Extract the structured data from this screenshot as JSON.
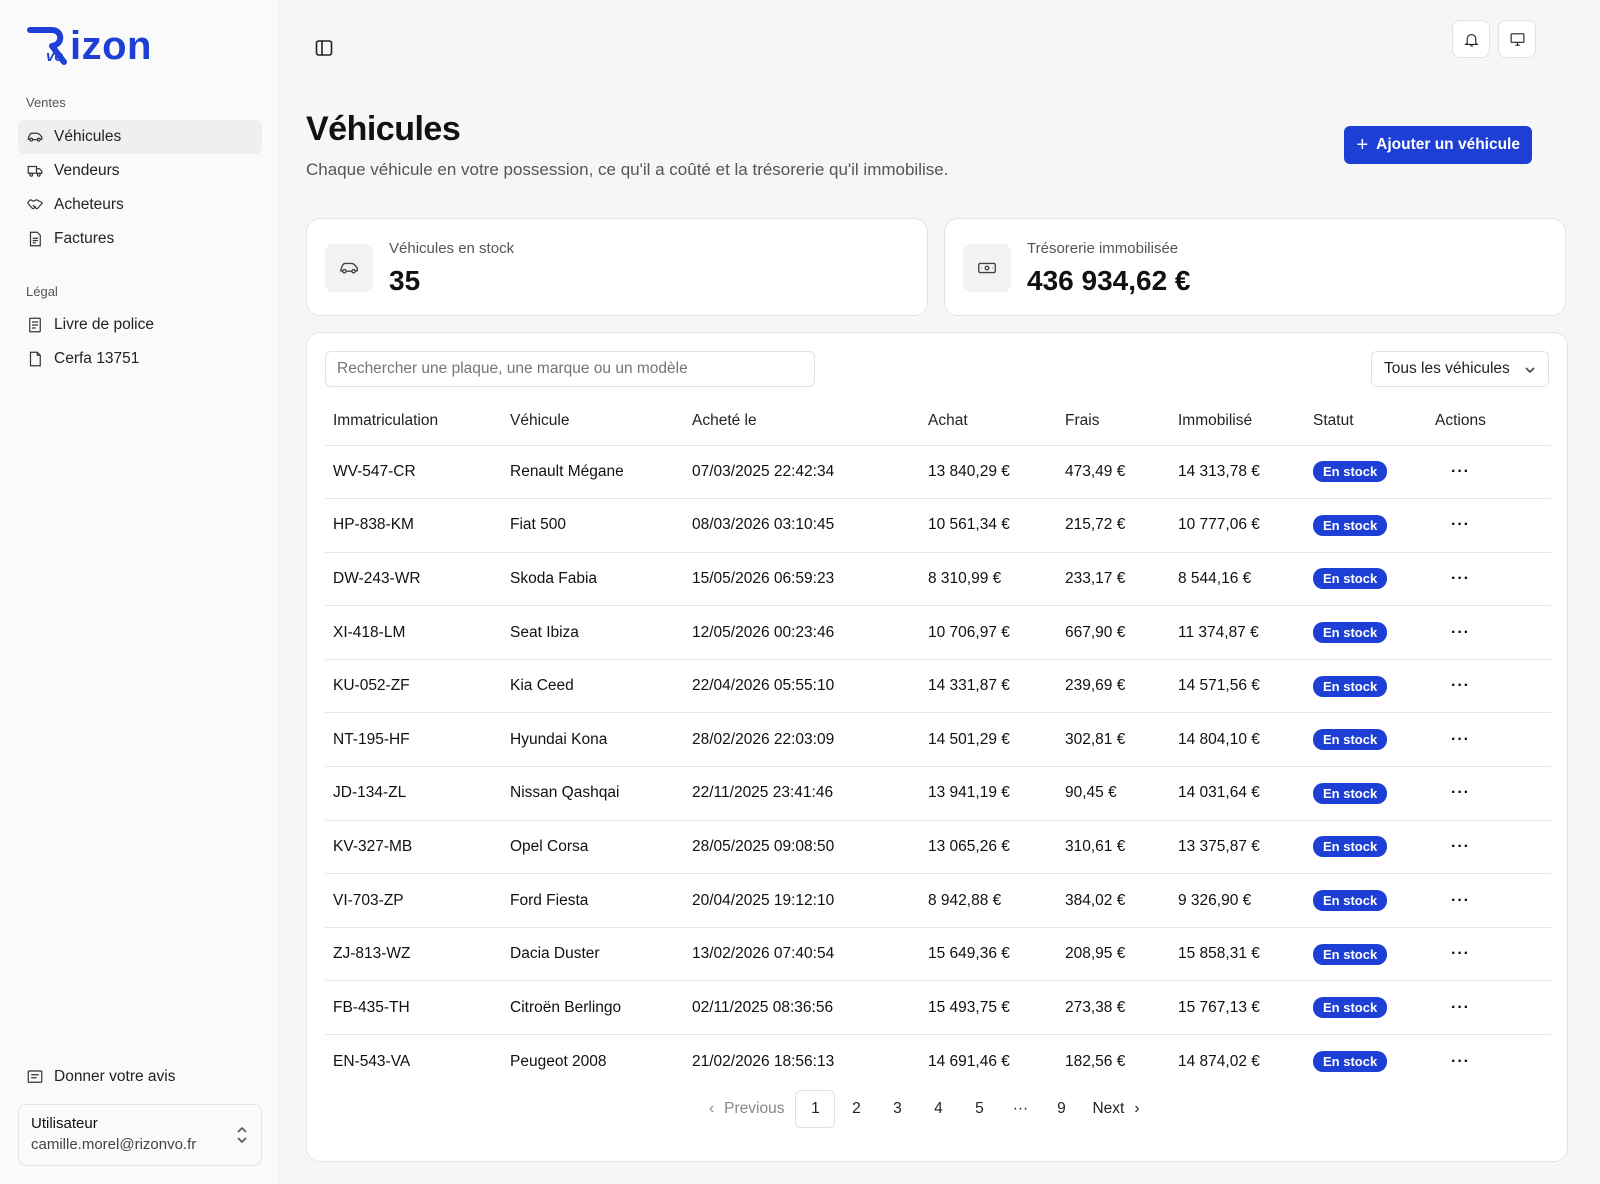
{
  "brand": {
    "logo_text": "izon",
    "logo_sub": "vo",
    "accent": "#1d3fd6"
  },
  "sidebar": {
    "sections": [
      {
        "title": "Ventes",
        "items": [
          {
            "label": "Véhicules",
            "icon": "car-icon",
            "active": true
          },
          {
            "label": "Vendeurs",
            "icon": "truck-icon"
          },
          {
            "label": "Acheteurs",
            "icon": "handshake-icon"
          },
          {
            "label": "Factures",
            "icon": "invoice-icon"
          }
        ]
      },
      {
        "title": "Légal",
        "items": [
          {
            "label": "Livre de police",
            "icon": "book-icon"
          },
          {
            "label": "Cerfa 13751",
            "icon": "document-icon"
          }
        ]
      }
    ],
    "feedback_label": "Donner votre avis",
    "user": {
      "name": "Utilisateur",
      "email": "camille.morel@rizonvo.fr"
    }
  },
  "header": {
    "title": "Véhicules",
    "subtitle": "Chaque véhicule en votre possession, ce qu'il a coûté et la trésorerie qu'il immobilise.",
    "add_button": "Ajouter un véhicule"
  },
  "stats": {
    "stock": {
      "label": "Véhicules en stock",
      "value": "35"
    },
    "tresorerie": {
      "label": "Trésorerie immobilisée",
      "value": "436 934,62 €"
    }
  },
  "table": {
    "search_placeholder": "Rechercher une plaque, une marque ou un modèle",
    "filter_value": "Tous les véhicules",
    "columns": [
      "Immatriculation",
      "Véhicule",
      "Acheté le",
      "Achat",
      "Frais",
      "Immobilisé",
      "Statut",
      "Actions"
    ],
    "rows": [
      [
        "WV-547-CR",
        "Renault Mégane",
        "07/03/2025 22:42:34",
        "13 840,29 €",
        "473,49 €",
        "14 313,78 €",
        "En stock"
      ],
      [
        "HP-838-KM",
        "Fiat 500",
        "08/03/2026 03:10:45",
        "10 561,34 €",
        "215,72 €",
        "10 777,06 €",
        "En stock"
      ],
      [
        "DW-243-WR",
        "Skoda Fabia",
        "15/05/2026 06:59:23",
        "8 310,99 €",
        "233,17 €",
        "8 544,16 €",
        "En stock"
      ],
      [
        "XI-418-LM",
        "Seat Ibiza",
        "12/05/2026 00:23:46",
        "10 706,97 €",
        "667,90 €",
        "11 374,87 €",
        "En stock"
      ],
      [
        "KU-052-ZF",
        "Kia Ceed",
        "22/04/2026 05:55:10",
        "14 331,87 €",
        "239,69 €",
        "14 571,56 €",
        "En stock"
      ],
      [
        "NT-195-HF",
        "Hyundai Kona",
        "28/02/2026 22:03:09",
        "14 501,29 €",
        "302,81 €",
        "14 804,10 €",
        "En stock"
      ],
      [
        "JD-134-ZL",
        "Nissan Qashqai",
        "22/11/2025 23:41:46",
        "13 941,19 €",
        "90,45 €",
        "14 031,64 €",
        "En stock"
      ],
      [
        "KV-327-MB",
        "Opel Corsa",
        "28/05/2025 09:08:50",
        "13 065,26 €",
        "310,61 €",
        "13 375,87 €",
        "En stock"
      ],
      [
        "VI-703-ZP",
        "Ford Fiesta",
        "20/04/2025 19:12:10",
        "8 942,88 €",
        "384,02 €",
        "9 326,90 €",
        "En stock"
      ],
      [
        "ZJ-813-WZ",
        "Dacia Duster",
        "13/02/2026 07:40:54",
        "15 649,36 €",
        "208,95 €",
        "15 858,31 €",
        "En stock"
      ],
      [
        "FB-435-TH",
        "Citroën Berlingo",
        "02/11/2025 08:36:56",
        "15 493,75 €",
        "273,38 €",
        "15 767,13 €",
        "En stock"
      ],
      [
        "EN-543-VA",
        "Peugeot 2008",
        "21/02/2026 18:56:13",
        "14 691,46 €",
        "182,56 €",
        "14 874,02 €",
        "En stock"
      ]
    ],
    "actions_glyph": "···"
  },
  "pagination": {
    "previous": "Previous",
    "next": "Next",
    "pages": [
      "1",
      "2",
      "3",
      "4",
      "5",
      "···",
      "9"
    ],
    "current": "1"
  }
}
